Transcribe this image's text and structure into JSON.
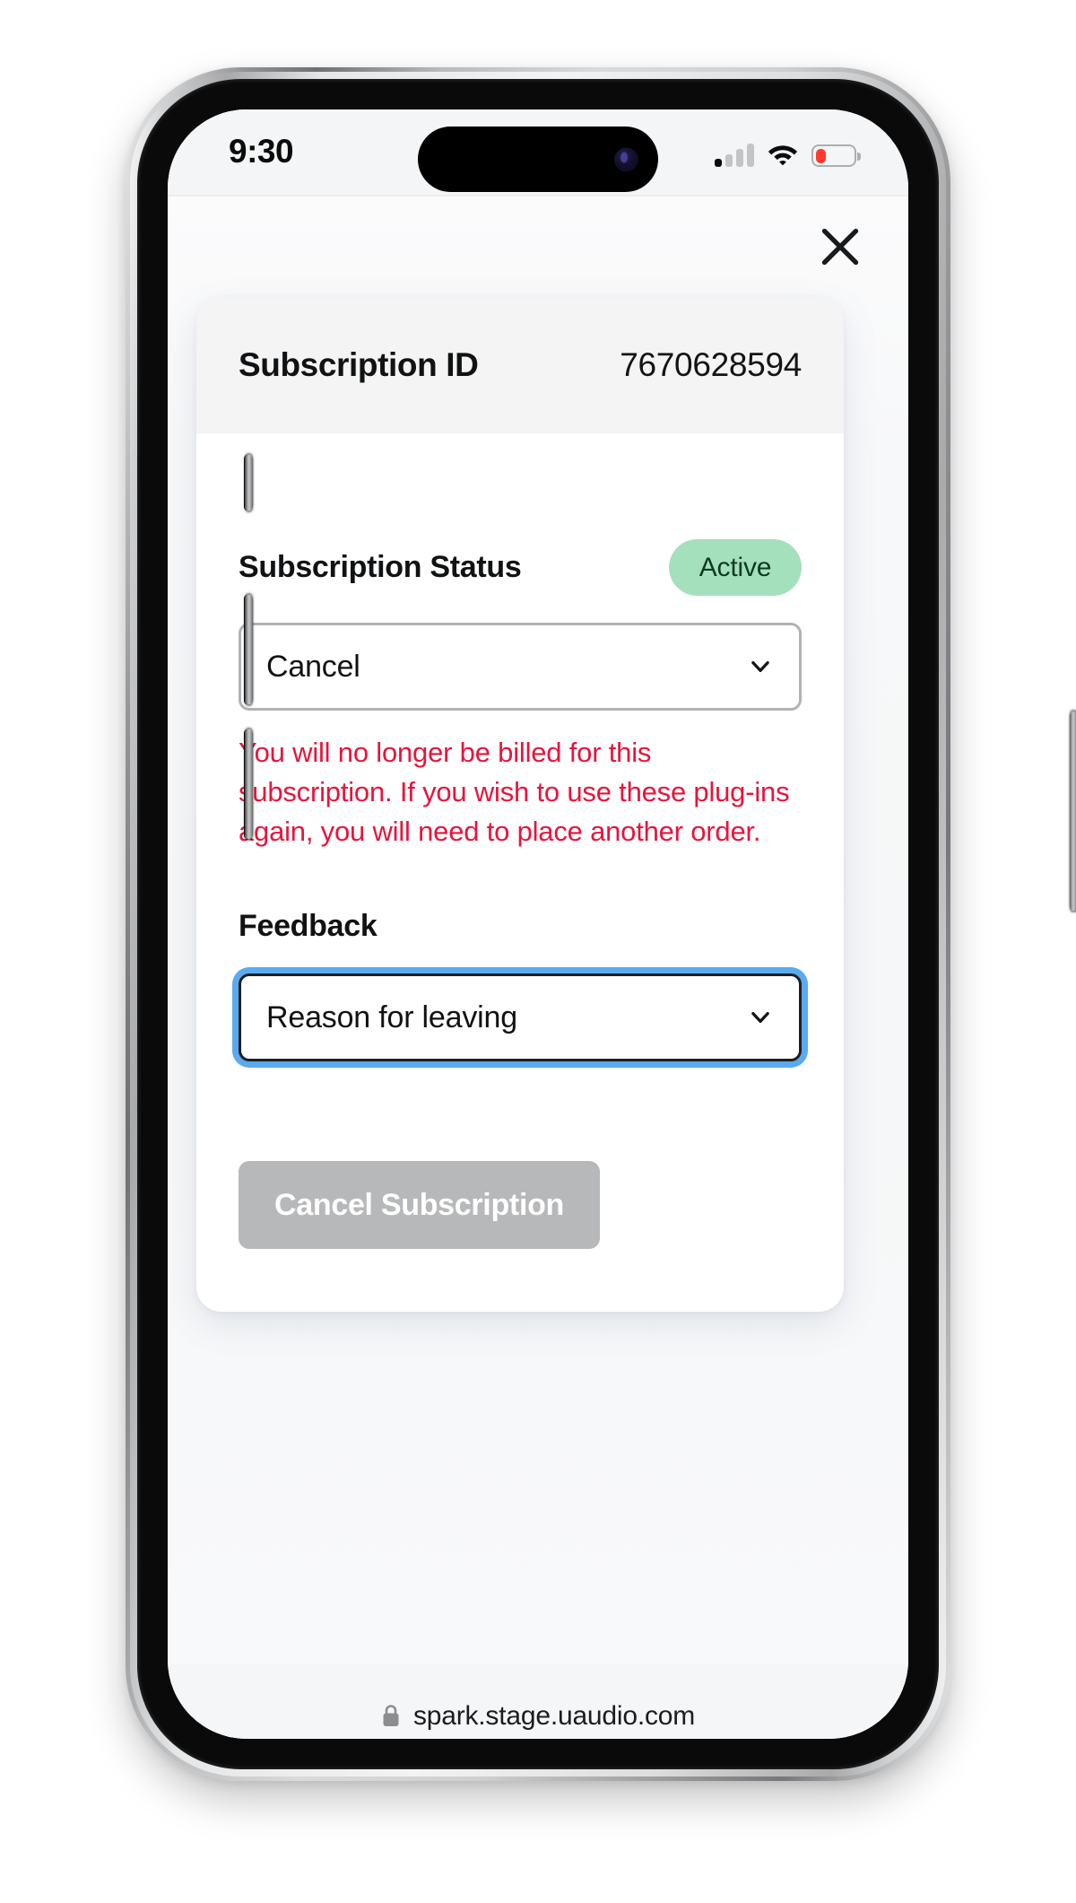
{
  "device": {
    "status_bar": {
      "time": "9:30",
      "icons": [
        "signal-bars-icon",
        "wifi-icon",
        "battery-low-icon"
      ],
      "battery_level_percent": 20,
      "signal_bars_filled": 1,
      "signal_bars_total": 4
    },
    "home_indicator": "home-indicator"
  },
  "browser": {
    "url": "spark.stage.uaudio.com",
    "secure_icon": "lock-icon"
  },
  "page": {
    "close_button": {
      "icon": "close-icon",
      "label": "Close"
    },
    "card": {
      "header": {
        "label": "Subscription ID",
        "value": "7670628594"
      },
      "status_section": {
        "title": "Subscription Status",
        "badge": {
          "text": "Active",
          "bg_color": "#a5e0bd",
          "text_color": "#0d3a21"
        },
        "select": {
          "value": "Cancel",
          "chevron_icon": "chevron-down-icon",
          "focused": false
        },
        "warning_text": "You will no longer be billed for this subscription. If you wish to use these plug-ins again, you will need to place another order.",
        "warning_color": "#e8143c"
      },
      "feedback_section": {
        "title": "Feedback",
        "select": {
          "value": "Reason for leaving",
          "chevron_icon": "chevron-down-icon",
          "focused": true,
          "focus_ring_color": "#5aaaf0"
        }
      },
      "submit_button": {
        "label": "Cancel Subscription",
        "disabled": true,
        "bg_color": "#b7b8ba",
        "text_color": "#ffffff"
      }
    }
  }
}
